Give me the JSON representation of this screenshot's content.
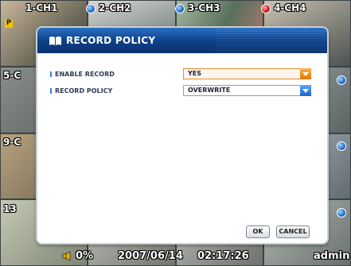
{
  "cameras": {
    "ch1": "1-CH1",
    "ch2": "2-CH2",
    "ch3": "3-CH3",
    "ch4": "4-CH4",
    "ch5": "5-C",
    "ch9": "9-C",
    "ch13": "13",
    "badge": "P"
  },
  "dialog": {
    "title": "RECORD POLICY",
    "rows": [
      {
        "label": "ENABLE RECORD",
        "value": "YES"
      },
      {
        "label": "RECORD POLICY",
        "value": "OVERWRITE"
      }
    ],
    "ok_label": "OK",
    "cancel_label": "CANCEL"
  },
  "status": {
    "volume": "0%",
    "date": "2007/06/14",
    "time": "02:17:26",
    "user": "admin"
  },
  "colors": {
    "accent": "#0d3f86",
    "dropdown_active": "#e07a00",
    "dropdown_normal": "#1d62c8"
  }
}
